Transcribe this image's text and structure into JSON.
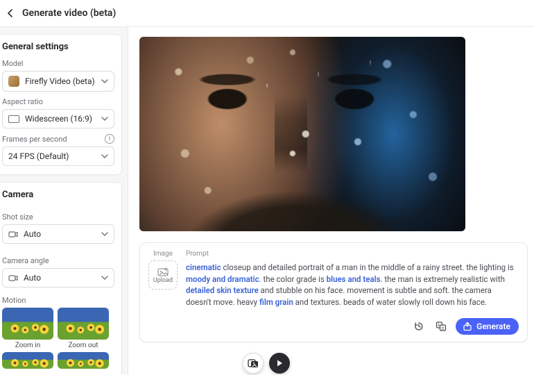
{
  "topbar": {
    "title": "Generate video (beta)"
  },
  "general": {
    "heading": "General settings",
    "model_label": "Model",
    "model_value": "Firefly Video (beta)",
    "aspect_label": "Aspect ratio",
    "aspect_value": "Widescreen (16:9)",
    "fps_label": "Frames per second",
    "fps_value": "24 FPS (Default)"
  },
  "camera": {
    "heading": "Camera",
    "shot_label": "Shot size",
    "shot_value": "Auto",
    "angle_label": "Camera angle",
    "angle_value": "Auto",
    "motion_label": "Motion",
    "motion_items": [
      "Zoom in",
      "Zoom out"
    ]
  },
  "preview": {
    "alt": "Cinematic closeup portrait of a man with rain and bokeh, warm left light and cool blue right light"
  },
  "prompt": {
    "image_label": "Image",
    "upload_label": "Upload",
    "prompt_label": "Prompt",
    "segments": [
      {
        "t": "cinematic",
        "k": true
      },
      {
        "t": " closeup and detailed portrait of a man in the middle of a rainy street. the lighting is ",
        "k": false
      },
      {
        "t": "moody and dramatic",
        "k": true
      },
      {
        "t": ". the color grade is ",
        "k": false
      },
      {
        "t": "blues and teals",
        "k": true
      },
      {
        "t": ". the man is extremely realistic with ",
        "k": false
      },
      {
        "t": "detailed skin texture",
        "k": true
      },
      {
        "t": " and stubble on his face. movement is subtle and soft. the camera doesn't move. heavy ",
        "k": false
      },
      {
        "t": "film grain",
        "k": true
      },
      {
        "t": " and textures. beads of water slowly roll down his face.",
        "k": false
      }
    ],
    "generate_label": "Generate"
  },
  "icons": {
    "back": "chevron-left",
    "info": "i",
    "chev_down": "chevron-down",
    "cam": "camera",
    "history": "history",
    "translate": "translate",
    "share": "share",
    "upload": "upload",
    "compare": "image-compare",
    "play": "play"
  }
}
